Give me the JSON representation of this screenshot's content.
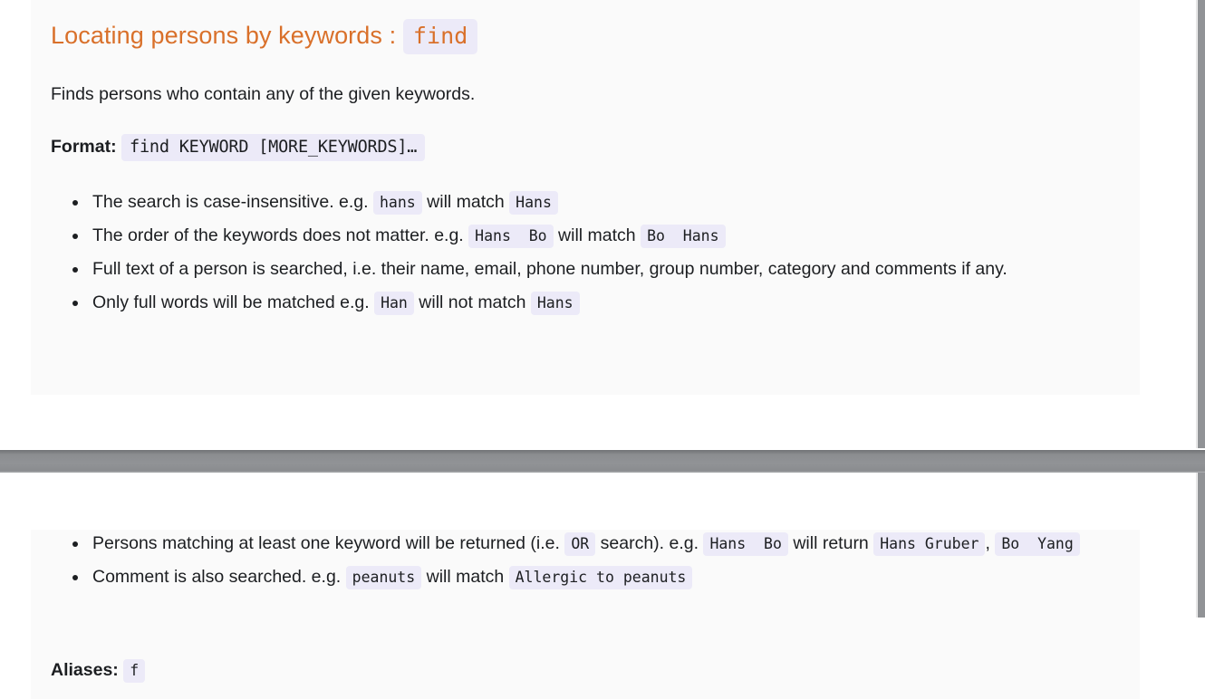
{
  "theme": {
    "heading_color": "#d9702a",
    "code_bg": "#eceaf8",
    "text_color": "#1c1e21",
    "card_bg": "#fafafa",
    "divider_color": "#919396"
  },
  "top_section": {
    "heading": {
      "text": "Locating persons by keywords : ",
      "code": "find"
    },
    "intro": "Finds persons who contain any of the given keywords.",
    "format": {
      "label": "Format:",
      "code": "find KEYWORD [MORE_KEYWORDS]…"
    },
    "bullets": [
      {
        "part1": "The search is case-insensitive. e.g. ",
        "code1": "hans",
        "part2": " will match ",
        "code2": "Hans",
        "part3": ""
      },
      {
        "part1": "The order of the keywords does not matter. e.g. ",
        "code1": "Hans  Bo",
        "part2": " will match ",
        "code2": "Bo  Hans",
        "part3": ""
      },
      {
        "part1": "Full text of a person is searched, i.e. their name, email, phone number, group number, category and comments if any.",
        "code1": "",
        "part2": "",
        "code2": "",
        "part3": ""
      },
      {
        "part1": "Only full words will be matched e.g. ",
        "code1": "Han",
        "part2": " will not match ",
        "code2": "Hans",
        "part3": ""
      }
    ]
  },
  "bottom_section": {
    "bullets": [
      {
        "part1": "Persons matching at least one keyword will be returned (i.e. ",
        "code1": "OR",
        "part2": " search). e.g. ",
        "code2": "Hans  Bo",
        "part3": " will return ",
        "code3": "Hans Gruber",
        "part4": ", ",
        "code4": "Bo  Yang",
        "part5": ""
      },
      {
        "part1": "Comment is also searched. e.g. ",
        "code1": "peanuts",
        "part2": " will match ",
        "code2": "Allergic to peanuts",
        "part3": "",
        "code3": "",
        "part4": "",
        "code4": "",
        "part5": ""
      }
    ],
    "aliases": {
      "label": "Aliases:",
      "code": "f"
    }
  }
}
